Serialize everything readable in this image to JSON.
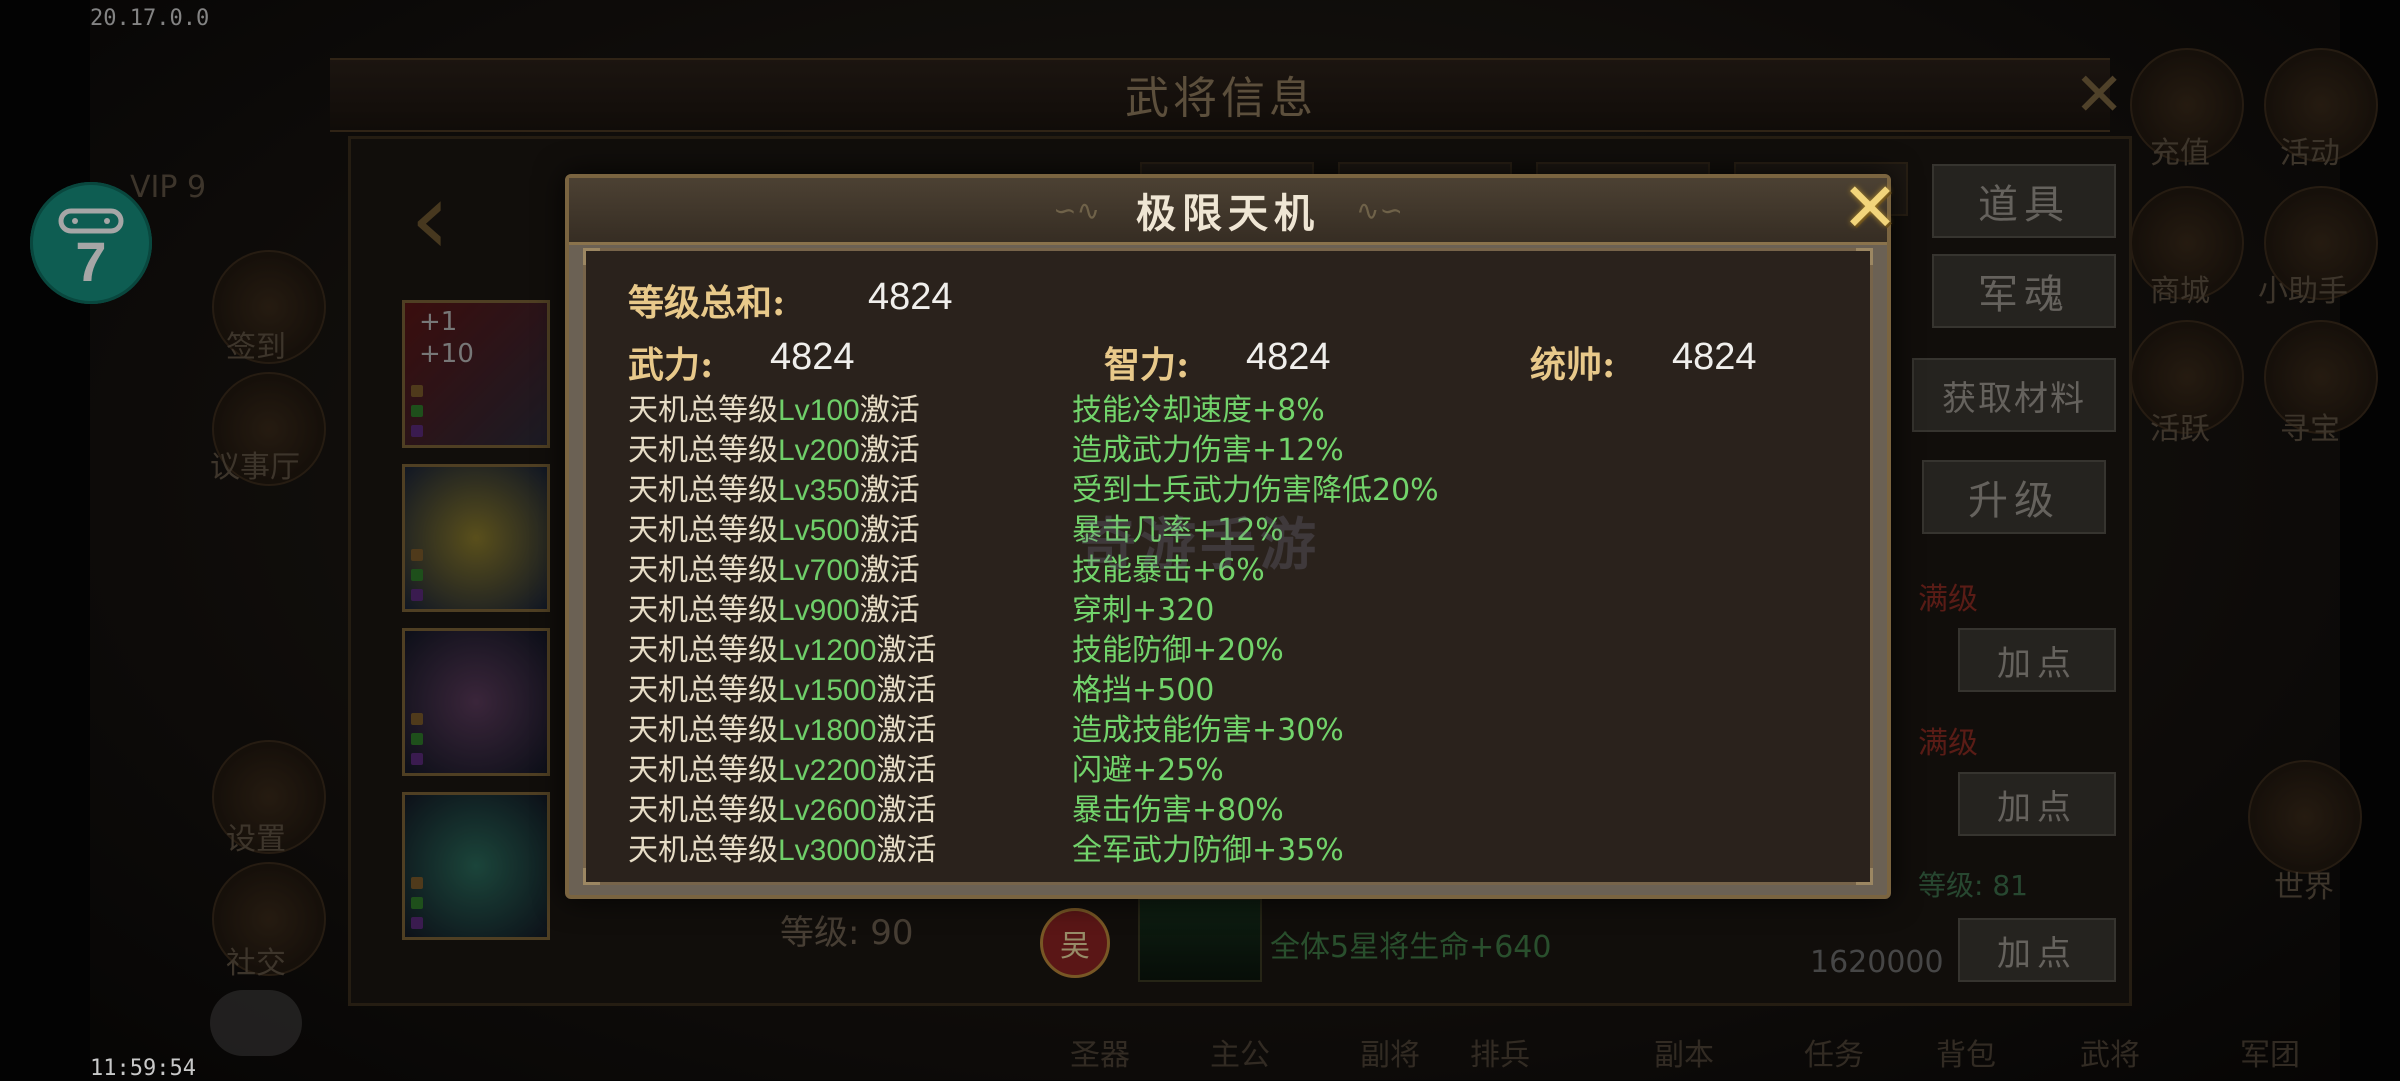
{
  "debug": {
    "version": "20.17.0.0",
    "clock": "11:59:54"
  },
  "float_button": {
    "label": "7"
  },
  "background": {
    "title": "武将信息",
    "vip": "VIP 9",
    "side_buttons": [
      "道具",
      "军魂",
      "获取材料",
      "升级"
    ],
    "add_point_label": "加点",
    "max_level_label": "满级",
    "level_label": "等级: 90",
    "hero_badge": "吴",
    "skill_text": "全体5星将生命+640",
    "money": "1620000",
    "right_level_text": "等级: 81",
    "left_labels": [
      "签到",
      "议事厅",
      "设置",
      "社交"
    ],
    "right_labels": [
      "充值",
      "活动",
      "商城",
      "小助手",
      "活跃",
      "寻宝",
      "世界"
    ],
    "bottom_menu": [
      "圣器",
      "主公",
      "副将",
      "排兵",
      "副本",
      "任务",
      "背包",
      "武将",
      "军团"
    ],
    "slot_badges": [
      "+1",
      "+10"
    ],
    "watermark": "奇游手游"
  },
  "modal": {
    "title": "极限天机",
    "total_label": "等级总和:",
    "total_value": "4824",
    "stats": [
      {
        "label": "武力:",
        "value": "4824"
      },
      {
        "label": "智力:",
        "value": "4824"
      },
      {
        "label": "统帅:",
        "value": "4824"
      }
    ],
    "rows": [
      {
        "prefix": "天机总等级",
        "lv": "Lv100",
        "suffix": "激活",
        "effect": "技能冷却速度+8%"
      },
      {
        "prefix": "天机总等级",
        "lv": "Lv200",
        "suffix": "激活",
        "effect": "造成武力伤害+12%"
      },
      {
        "prefix": "天机总等级",
        "lv": "Lv350",
        "suffix": "激活",
        "effect": "受到士兵武力伤害降低20%"
      },
      {
        "prefix": "天机总等级",
        "lv": "Lv500",
        "suffix": "激活",
        "effect": "暴击几率+12%"
      },
      {
        "prefix": "天机总等级",
        "lv": "Lv700",
        "suffix": "激活",
        "effect": "技能暴击+6%"
      },
      {
        "prefix": "天机总等级",
        "lv": "Lv900",
        "suffix": "激活",
        "effect": "穿刺+320"
      },
      {
        "prefix": "天机总等级",
        "lv": "Lv1200",
        "suffix": "激活",
        "effect": "技能防御+20%"
      },
      {
        "prefix": "天机总等级",
        "lv": "Lv1500",
        "suffix": "激活",
        "effect": "格挡+500"
      },
      {
        "prefix": "天机总等级",
        "lv": "Lv1800",
        "suffix": "激活",
        "effect": "造成技能伤害+30%"
      },
      {
        "prefix": "天机总等级",
        "lv": "Lv2200",
        "suffix": "激活",
        "effect": "闪避+25%"
      },
      {
        "prefix": "天机总等级",
        "lv": "Lv2600",
        "suffix": "激活",
        "effect": "暴击伤害+80%"
      },
      {
        "prefix": "天机总等级",
        "lv": "Lv3000",
        "suffix": "激活",
        "effect": "全军武力防御+35%"
      }
    ]
  },
  "colors": {
    "gold_label": "#e8c98a",
    "green_effect": "#72d46b",
    "teal_button": "#16907f"
  }
}
